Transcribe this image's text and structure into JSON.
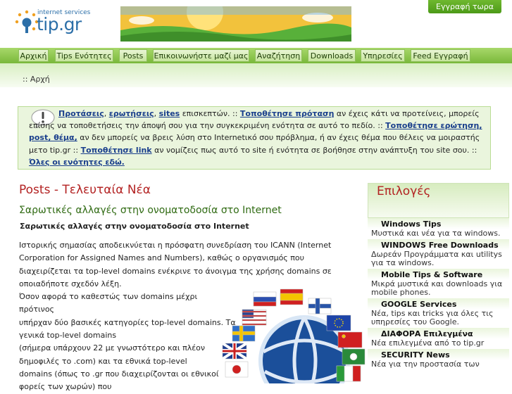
{
  "header": {
    "logo_services": "internet services",
    "logo_name": "tip.gr",
    "register_label": "Εγγραφή τωρα"
  },
  "nav": {
    "items": [
      "Αρχική",
      "Tips Ενότητες",
      "Posts",
      "Επικοινωνήστε μαζί μας",
      "Αναζήτηση",
      "Downloads",
      "Υπηρεσίες",
      "Feed Εγγραφή"
    ]
  },
  "breadcrumb": ":: Αρχή",
  "notice": {
    "p1": "Προτάσεις",
    "s1": ", ",
    "p2": "ερωτήσεις",
    "s2": ", ",
    "p3": "sites",
    "t1": " επισκεπτών. :: ",
    "p4": "Τοποθέτησε πρόταση",
    "t2": " αν έχεις κάτι να προτείνεις, μπορείς επίσης να τοποθετήσεις την άποψή σου για την συγκεκριμένη ενότητα σε αυτό το πεδίο. :: ",
    "p5": "Τοποθέτησε ερώτηση, post, θέμα,",
    "t3": " αν δεν μπορείς να βρεις λύση στο Internetικό σου πρόβλημα, ή αν έχεις θέμα που θέλεις να μοιραστής μετο tip.gr :: ",
    "p6": "Τοποθέτησε link",
    "t4": " αν νομίζεις πως αυτό το site ή ενότητα σε βοήθησε στην ανάπτυξη του site σου. :: ",
    "p7": "Όλες οι ενότητες εδώ."
  },
  "main": {
    "title": "Posts - Τελευταία Νέα",
    "post_title": "Σαρωτικές αλλαγές στην ονοματοδοσία στο Internet",
    "post_sub": "Σαρωτικές αλλαγές στην ονοματοδοσία στο Internet",
    "lines": [
      "Ιστορικής σημασίας αποδεικνύεται η πρόσφατη συνεδρίαση του ICANN (Internet",
      "Corporation for Assigned Names and Numbers), καθώς ο οργανισμός που",
      "διαχειρίζεται τα top-level domains ενέκρινε το άνοιγμα της χρήσης domains σε",
      "οποιαδήποτε σχεδόν λέξη.",
      "Όσον αφορά το καθεστώς των domains μέχρι",
      "πρότινος",
      "υπήρχαν δύο βασικές κατηγορίες top-level domains. Τα",
      "γενικά top-level domains",
      "(σήμερα υπάρχουν 22 με γνωστότερο και πλέον",
      "δημοφιλές το .com) και τα εθνικά top-level",
      "domains (όπως το .gr που διαχειρίζονται οι εθνικοί",
      "φορείς των χωρών) που"
    ]
  },
  "sidebar": {
    "title": "Επιλογές",
    "items": [
      {
        "title": "Windows Tips",
        "desc": "Μυστικά και νέα για τα windows."
      },
      {
        "title": "WINDOWS Free Downloads",
        "desc": "Δωρεάν Προγράμματα και utilitys για τα windows."
      },
      {
        "title": "Mobile Tips & Software",
        "desc": "Μικρά μυστικά και downloads για mobile phones."
      },
      {
        "title": "GOOGLE Services",
        "desc": "Νέα, tips και tricks για όλες τις υπηρεσίες του Google."
      },
      {
        "title": "ΔΙΑΦΟΡΑ Επιλεγμένα",
        "desc": "Νέα επιλεγμένα από το tip.gr"
      },
      {
        "title": "SECURITY News",
        "desc": "Νέα για την προστασία των"
      }
    ]
  }
}
